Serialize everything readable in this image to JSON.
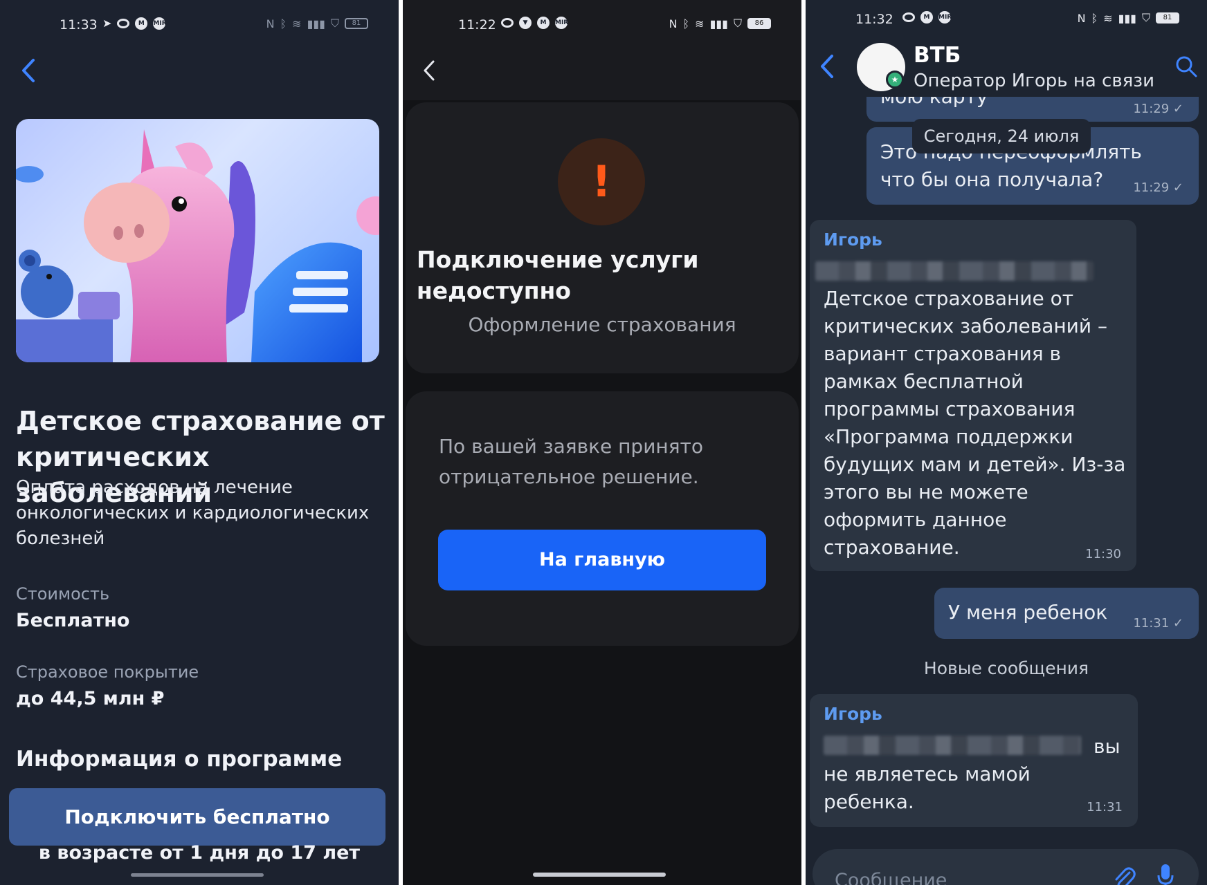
{
  "panel1": {
    "status": {
      "time": "11:33",
      "battery": "81"
    },
    "title": "Детское страхование от критических заболеваний",
    "subtitle": "Оплата расходов на лечение онкологических и кардиологических болезней",
    "cost_label": "Стоимость",
    "cost_value": "Бесплатно",
    "coverage_label": "Страховое покрытие",
    "coverage_value": "до 44,5 млн ₽",
    "info_heading": "Информация о программе",
    "cta_label": "Подключить бесплатно",
    "age_text": "в возрасте от 1 дня до 17 лет"
  },
  "panel2": {
    "status": {
      "time": "11:22",
      "battery": "86"
    },
    "warning_glyph": "!",
    "title": "Подключение услуги недоступно",
    "subtitle": "Оформление страхования",
    "message": "По вашей заявке принято отрицательное решение.",
    "button_label": "На главную"
  },
  "panel3": {
    "status": {
      "time": "11:32",
      "battery": "81"
    },
    "chat_name": "ВТБ",
    "chat_status": "Оператор Игорь на связи",
    "date_chip": "Сегодня, 24 июля",
    "msg_top_partial": "мою карту",
    "msg_top_time": "11:29 ✓",
    "msg_user1": "Это надо переоформлять что бы она получала?",
    "msg_user1_time": "11:29 ✓",
    "op_name": "Игорь",
    "op_msg1": "Детское страхование от критических заболеваний – вариант страхования в рамках бесплатной программы страхования «Программа поддержки будущих мам и детей». Из-за этого вы не можете оформить данное страхование.",
    "op_msg1_time": "11:30",
    "msg_user2": "У меня ребенок",
    "msg_user2_time": "11:31 ✓",
    "new_messages_label": "Новые сообщения",
    "op_msg2_tail": "вы",
    "op_msg2": "не являетесь мамой ребенка.",
    "op_msg2_time": "11:31",
    "composer_placeholder": "Сообщение"
  },
  "icons": [
    "back-arrow-icon",
    "warning-icon",
    "search-icon",
    "paperclip-icon",
    "microphone-icon",
    "telegram-icon",
    "wifi-icon",
    "bluetooth-icon",
    "signal-icon",
    "battery-icon"
  ],
  "colors": {
    "accent_blue": "#1964f7",
    "link_blue": "#3f84ff",
    "cta_muted": "#3c5b95",
    "warning_orange": "#ff5a1a"
  }
}
